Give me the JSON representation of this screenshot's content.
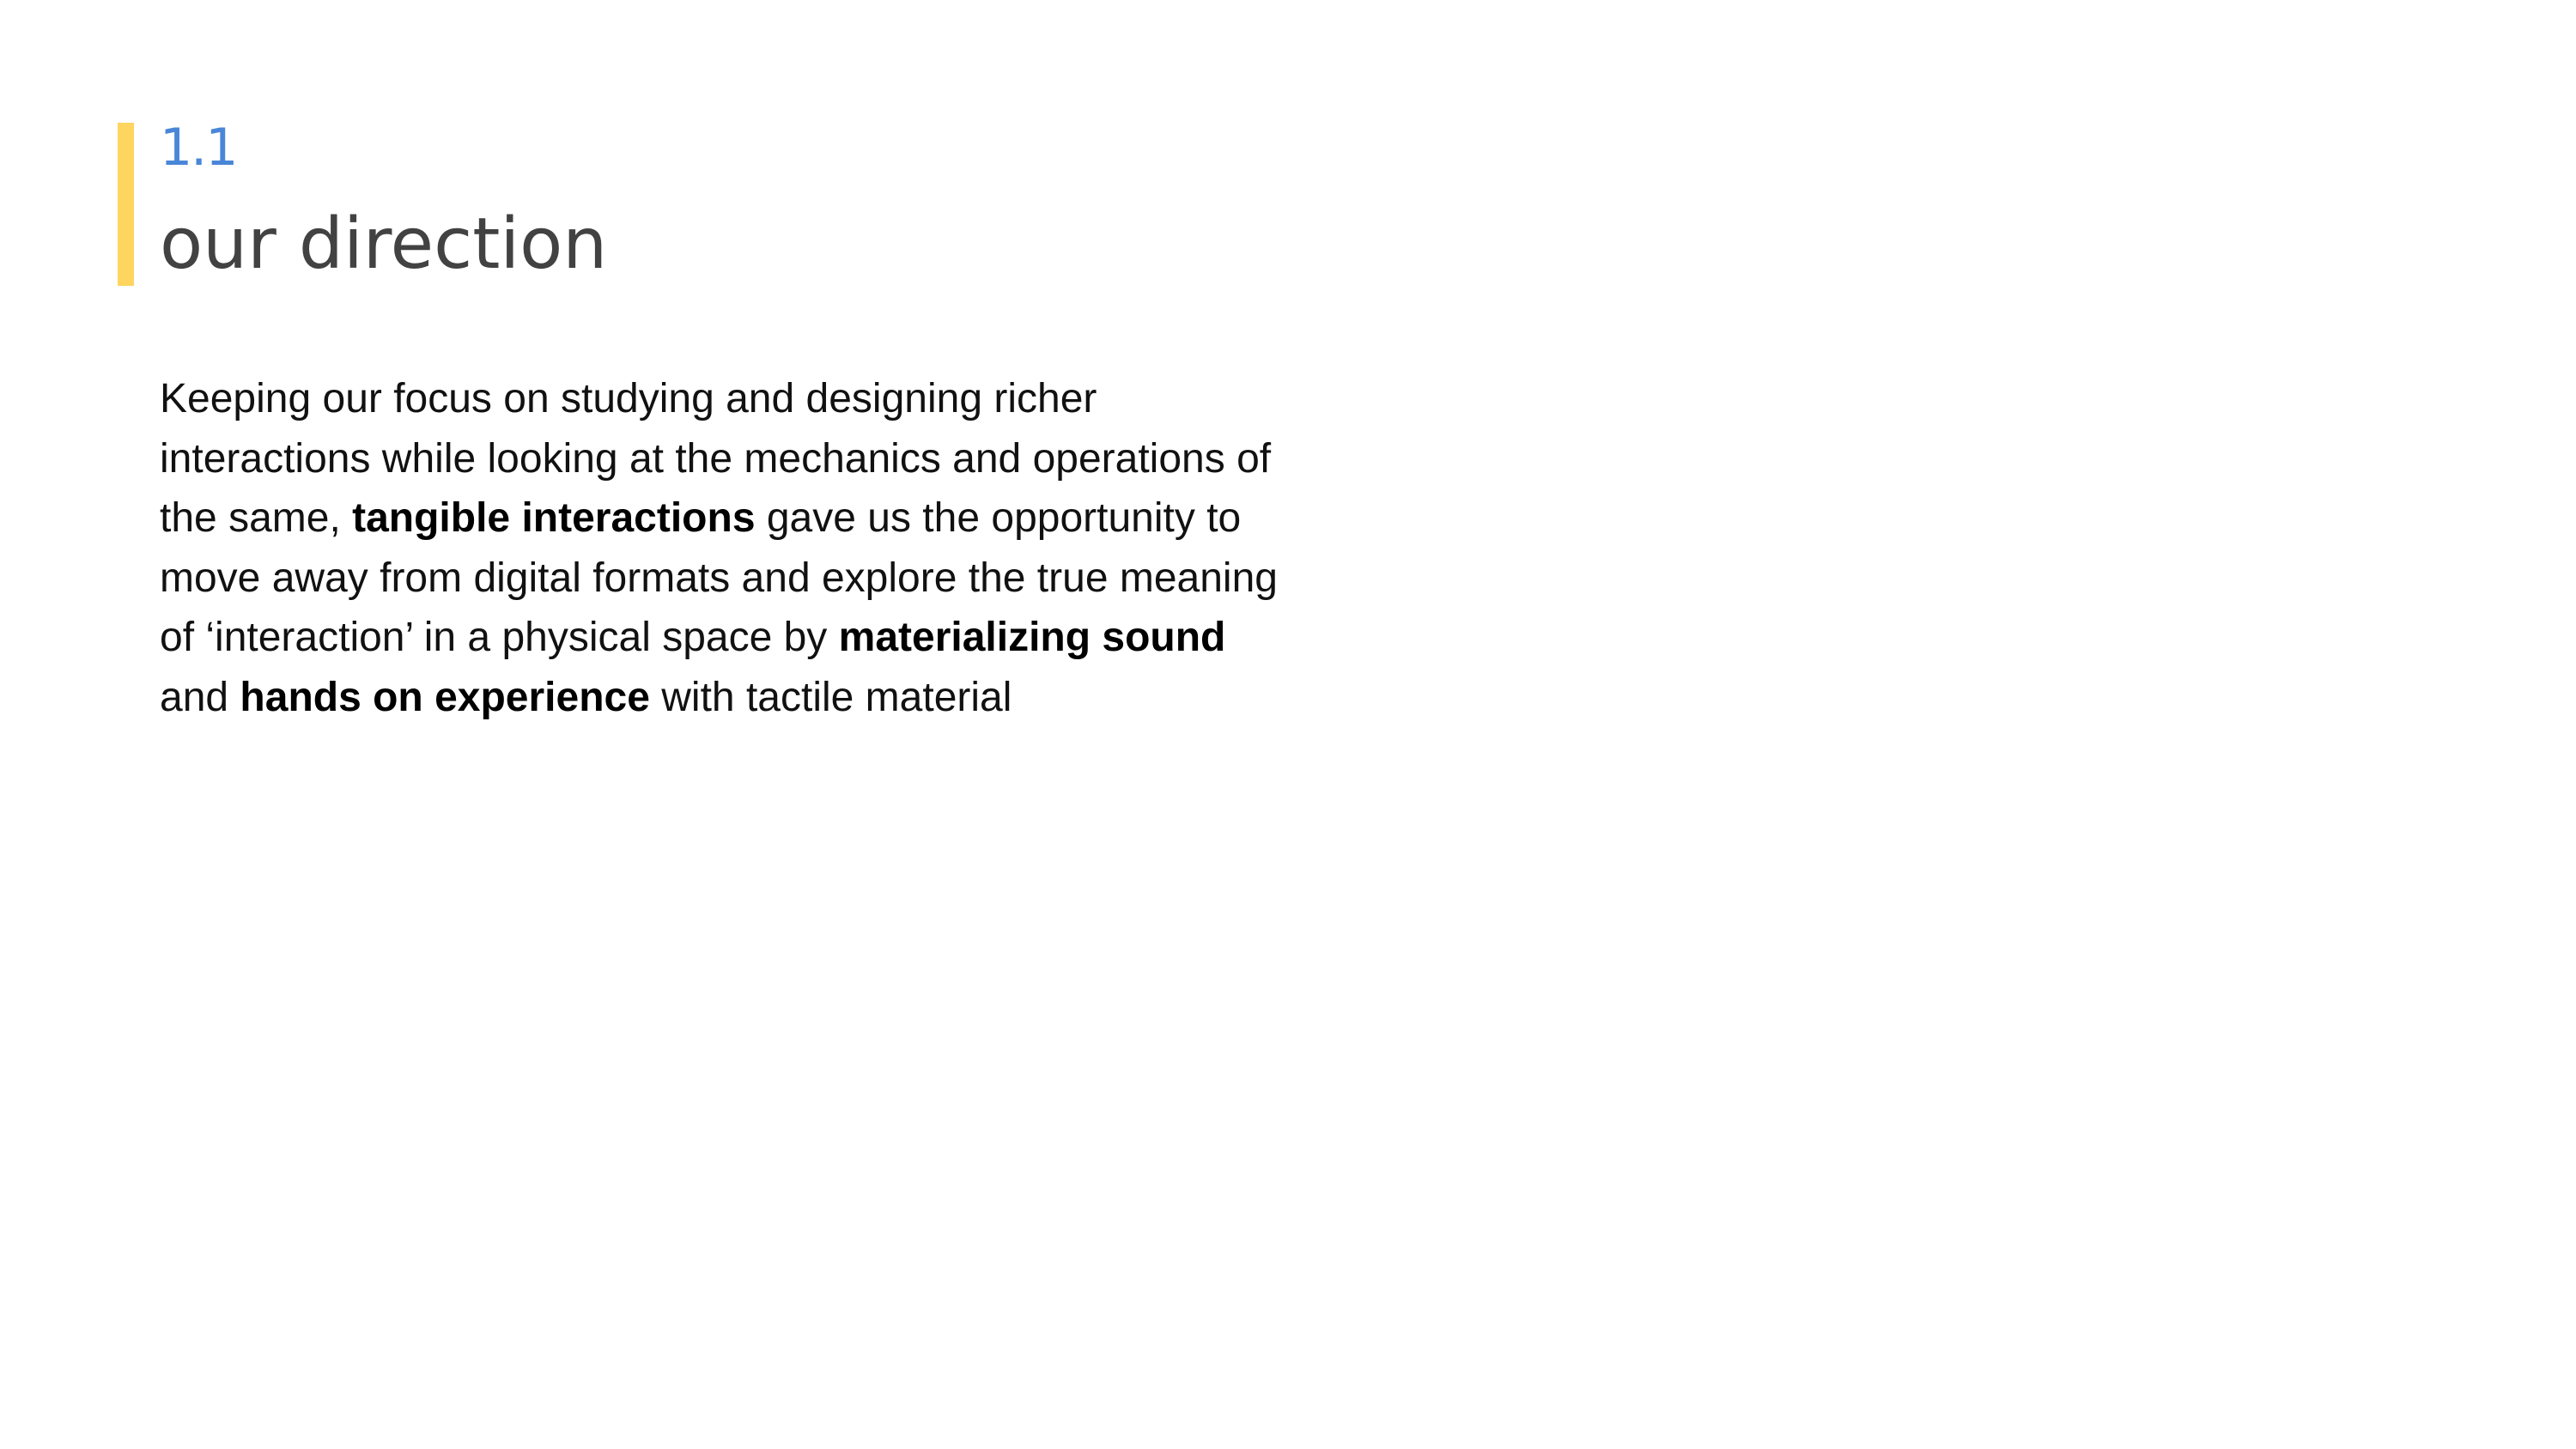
{
  "slide": {
    "section_number": "1.1",
    "title": "our direction",
    "colors": {
      "accent_bar": "#fdd55f",
      "section_number": "#4a86d8",
      "title": "#424242",
      "body": "#111111"
    },
    "body": {
      "l1": "Keeping our focus on studying and designing richer",
      "l2": "interactions while looking at the mechanics and operations of",
      "l3_a": "the same, ",
      "l3_b": "tangible interactions",
      "l3_c": " gave us the opportunity to",
      "l4": "move away from digital formats and explore the true meaning",
      "l5_a": "of ‘interaction’ in a physical space by ",
      "l5_b": "materializing sound",
      "l6_a": "and ",
      "l6_b": "hands on experience",
      "l6_c": " with tactile material"
    }
  }
}
